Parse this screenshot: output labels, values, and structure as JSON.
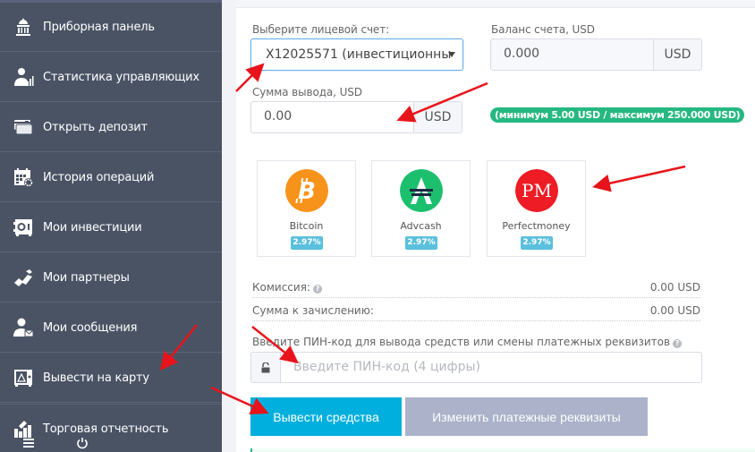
{
  "sidebar": {
    "items": [
      {
        "label": "Приборная панель",
        "icon": "capitol-building-icon"
      },
      {
        "label": "Статистика управляющих",
        "icon": "manager-stats-icon"
      },
      {
        "label": "Открыть депозит",
        "icon": "credit-cards-icon"
      },
      {
        "label": "История операций",
        "icon": "calendar-gear-icon"
      },
      {
        "label": "Мои инвестиции",
        "icon": "safe-icon"
      },
      {
        "label": "Мои партнеры",
        "icon": "handshake-icon"
      },
      {
        "label": "Мои сообщения",
        "icon": "user-mail-icon"
      },
      {
        "label": "Вывести на карту",
        "icon": "withdraw-safe-icon"
      },
      {
        "label": "Торговая отчетность",
        "icon": "trading-report-icon"
      }
    ],
    "footer_icons": [
      "menu-icon",
      "power-icon"
    ]
  },
  "form": {
    "account_label": "Выберите лицевой счет:",
    "account_value": "X12025571 (инвестиционны",
    "balance_label": "Баланс счета, USD",
    "balance_value": "0.000",
    "balance_currency": "USD",
    "amount_label": "Сумма вывода, USD",
    "amount_value": "0.00",
    "amount_currency": "USD",
    "limits_badge": "(минимум 5.00 USD / максимум 250.000 USD)",
    "payment_systems": [
      {
        "name": "Bitcoin",
        "rate": "2.97%",
        "color": "#f7931a"
      },
      {
        "name": "Advcash",
        "rate": "2.97%",
        "color": "#1cbf6e"
      },
      {
        "name": "Perfectmoney",
        "rate": "2.97%",
        "color": "#ee1c25"
      }
    ],
    "commission_label": "Комиссия:",
    "commission_value": "0.00 USD",
    "credited_label": "Сумма к зачислению:",
    "credited_value": "0.00 USD",
    "pin_label": "Введите ПИН-код для вывода средств или смены платежных реквизитов",
    "pin_placeholder": "Введите ПИН-код (4 цифры)",
    "withdraw_button": "Вывести средства",
    "change_details_button": "Изменить платежные реквизиты"
  },
  "colors": {
    "sidebar_bg": "#4a5364",
    "primary_button": "#00afdd",
    "secondary_button": "#abb2c9",
    "limits_badge": "#26b881",
    "rate_badge": "#5bc0de",
    "annotation_arrow": "#e8141b"
  }
}
